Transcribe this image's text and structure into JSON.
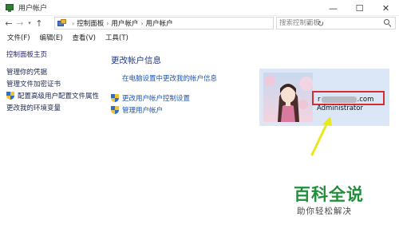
{
  "window": {
    "title": "用户帐户",
    "controls": {
      "minimize": "—",
      "maximize": "☐",
      "close": "✕"
    }
  },
  "address_bar": {
    "back": "←",
    "forward": "→",
    "up": "↑",
    "breadcrumb": [
      "控制面板",
      "用户帐户",
      "用户帐户"
    ],
    "refresh": "↻",
    "search_placeholder": "搜索控制面板"
  },
  "menu": [
    "文件(F)",
    "编辑(E)",
    "查看(V)",
    "工具(T)"
  ],
  "sidebar": {
    "home": "控制面板主页",
    "links": [
      "管理你的凭据",
      "管理文件加密证书",
      "配置高级用户配置文件属性",
      "更改我的环境变量"
    ]
  },
  "main": {
    "title": "更改帐户信息",
    "change_in_pc_settings": "在电脑设置中更改我的帐户信息",
    "uac_settings": "更改用户帐户控制设置",
    "manage_accounts": "管理用户帐户"
  },
  "user": {
    "email_prefix": "r",
    "email_suffix": ".com",
    "role": "Administrator"
  },
  "watermark": {
    "title": "百科全说",
    "subtitle": "助你轻松解决"
  },
  "colors": {
    "highlight_box": "#d32f2f",
    "annotation_arrow": "#e8e820",
    "user_card_bg": "#dbe7f6",
    "link": "#1a56b8",
    "watermark_green": "#1f8f3a"
  },
  "icons": {
    "app": "user-accounts-icon",
    "address": "control-panel-icon",
    "uac": "shield-icon",
    "search": "search-icon"
  }
}
